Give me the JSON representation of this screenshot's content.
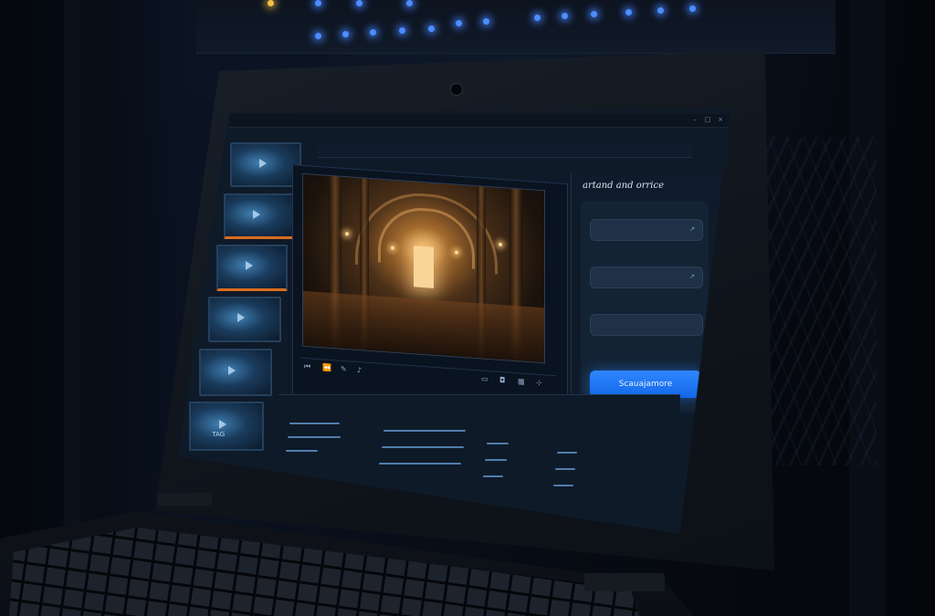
{
  "app": {
    "window_title": "",
    "window_controls": [
      "minimize",
      "maximize",
      "close"
    ]
  },
  "player": {
    "header": "",
    "controls": [
      "prev-icon",
      "rewind-icon",
      "edit-icon",
      "volume-icon",
      "timecode"
    ],
    "right_controls": [
      "folder-icon",
      "lock-icon",
      "grid-icon",
      "pin-icon"
    ]
  },
  "thumbnails": [
    {
      "caption": ""
    },
    {
      "caption": ""
    },
    {
      "caption": ""
    },
    {
      "caption": ""
    },
    {
      "caption": ""
    },
    {
      "caption": "TAG"
    }
  ],
  "settings": {
    "title": "artand and orrice",
    "fields": [
      {
        "label": "",
        "value": "",
        "icon": "edit-icon"
      },
      {
        "label": "",
        "value": "",
        "icon": "pin-icon"
      },
      {
        "label": "",
        "value": ""
      }
    ],
    "primary_button": "Scauajamore"
  },
  "table": {
    "header": "",
    "subheader": ""
  },
  "colors": {
    "accent": "#1f78ff",
    "active_marker": "#d86d1f",
    "panel": "#0f1b2a",
    "rack_led": "#4c8dff"
  }
}
